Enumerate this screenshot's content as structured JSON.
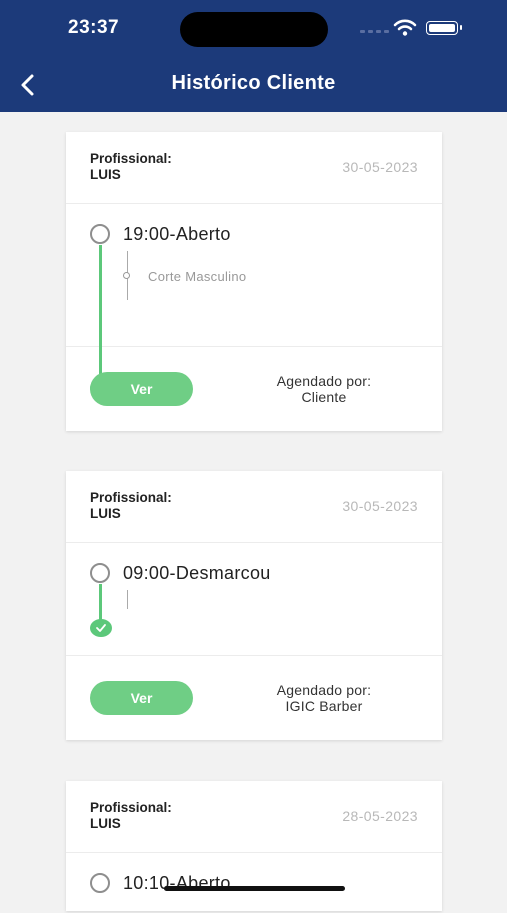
{
  "status_bar": {
    "time": "23:37"
  },
  "header": {
    "title": "Histórico Cliente"
  },
  "professional_label": "Profissional:",
  "agendado_label": "Agendado por:",
  "view_button_label": "Ver",
  "appointments": [
    {
      "professional": "LUIS",
      "date": "30-05-2023",
      "entry": "19:00-Aberto",
      "service": "Corte Masculino",
      "scheduled_by": "Cliente"
    },
    {
      "professional": "LUIS",
      "date": "30-05-2023",
      "entry": "09:00-Desmarcou",
      "service": "",
      "scheduled_by": "IGIC Barber"
    },
    {
      "professional": "LUIS",
      "date": "28-05-2023",
      "entry": "10:10-Aberto"
    }
  ],
  "colors": {
    "header": "#1c3a7a",
    "accent_green": "#6fce85",
    "background": "#f2f2f2"
  },
  "icons": [
    "back-arrow-icon",
    "wifi-icon",
    "battery-icon",
    "check-icon"
  ]
}
